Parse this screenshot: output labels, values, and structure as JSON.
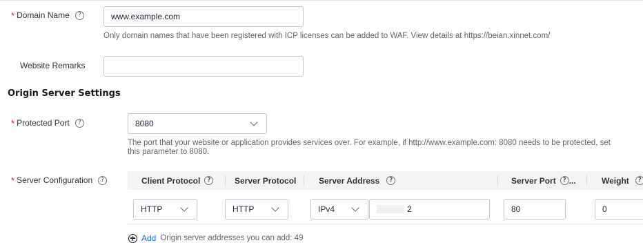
{
  "domain_name": {
    "label": "Domain Name",
    "value": "www.example.com",
    "hint": "Only domain names that have been registered with ICP licenses can be added to WAF. View details at https://beian.xinnet.com/"
  },
  "website_remarks": {
    "label": "Website Remarks",
    "value": ""
  },
  "origin_section": {
    "title": "Origin Server Settings"
  },
  "protected_port": {
    "label": "Protected Port",
    "value": "8080",
    "hint_line1": "The port that your website or application provides services over. For example, if http://www.example.com: 8080 needs to be protected, set",
    "hint_line2": "this parameter to 8080."
  },
  "server_configuration": {
    "label": "Server Configuration",
    "columns": {
      "client_protocol": "Client Protocol",
      "server_protocol": "Server Protocol",
      "server_address": "Server Address",
      "server_port": "Server Port",
      "server_port_suffix": "...",
      "weight": "Weight"
    },
    "row": {
      "client_protocol": "HTTP",
      "server_protocol": "HTTP",
      "address_type": "IPv4",
      "address": "2",
      "port": "80",
      "weight": "0"
    }
  },
  "add": {
    "link": "Add",
    "text": "Origin server addresses you can add: 49"
  },
  "colors": {
    "required": "#e0252f",
    "link": "#1a6dd6",
    "table_header": "#f3f4f6"
  },
  "icons": [
    "help-icon",
    "chevron-down-icon",
    "add-icon"
  ]
}
